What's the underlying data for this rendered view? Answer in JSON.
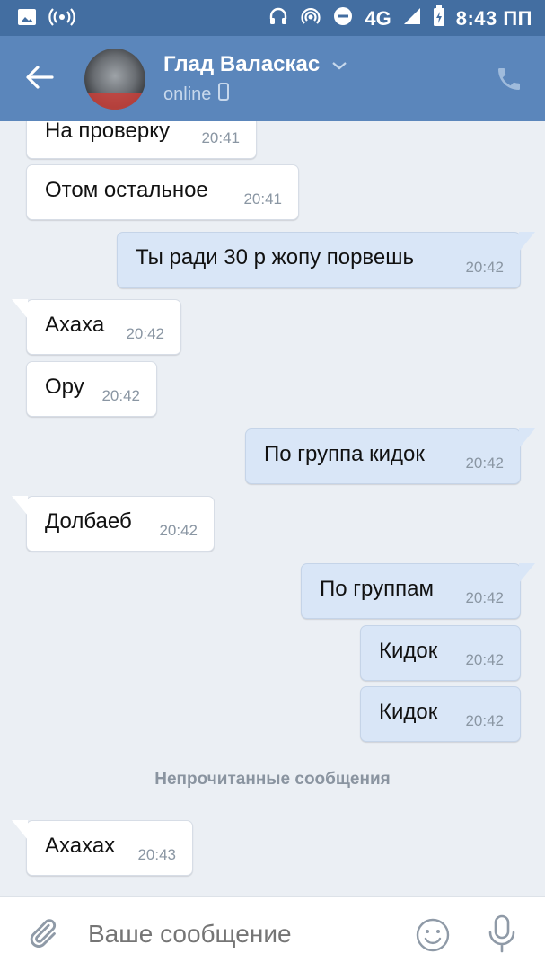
{
  "status_bar": {
    "network": "4G",
    "time": "8:43 ПП",
    "icons": [
      "image-icon",
      "broadcast-icon",
      "headphones-icon",
      "hotspot-icon",
      "do-not-disturb-icon",
      "signal-icon",
      "battery-icon"
    ]
  },
  "header": {
    "contact_name": "Глад Валаскас",
    "status": "online",
    "icons": [
      "back-arrow-icon",
      "chevron-down-icon",
      "mobile-icon",
      "phone-icon"
    ]
  },
  "messages": [
    {
      "dir": "in",
      "text": "На проверку",
      "time": "20:41"
    },
    {
      "dir": "in",
      "text": "Отом остальное",
      "time": "20:41"
    },
    {
      "dir": "out",
      "text": "Ты ради 30 р жопу порвешь",
      "time": "20:42"
    },
    {
      "dir": "in",
      "text": "Ахаха",
      "time": "20:42"
    },
    {
      "dir": "in",
      "text": "Ору",
      "time": "20:42"
    },
    {
      "dir": "out",
      "text": "По группа кидок",
      "time": "20:42"
    },
    {
      "dir": "in",
      "text": "Долбаеб",
      "time": "20:42"
    },
    {
      "dir": "out",
      "text": "По группам",
      "time": "20:42"
    },
    {
      "dir": "out",
      "text": "Кидок",
      "time": "20:42"
    },
    {
      "dir": "out",
      "text": "Кидок",
      "time": "20:42"
    },
    {
      "dir": "in",
      "text": "Ахахах",
      "time": "20:43"
    }
  ],
  "unread_divider": "Непрочитанные сообщения",
  "composer": {
    "placeholder": "Ваше сообщение",
    "icons": [
      "paperclip-icon",
      "emoji-icon",
      "microphone-icon"
    ]
  },
  "colors": {
    "status_bar": "#436ea1",
    "header": "#5b86bb",
    "chat_background": "#ebeff4",
    "incoming_bubble": "#ffffff",
    "outgoing_bubble": "#d9e6f7"
  }
}
